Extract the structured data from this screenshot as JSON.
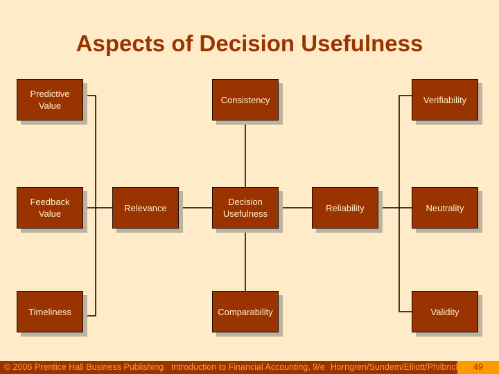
{
  "title": "Aspects of Decision Usefulness",
  "diagram": {
    "nodes": {
      "predictive_value": "Predictive\nValue",
      "feedback_value": "Feedback\nValue",
      "timeliness": "Timeliness",
      "relevance": "Relevance",
      "consistency": "Consistency",
      "decision_usefulness": "Decision\nUsefulness",
      "comparability": "Comparability",
      "reliability": "Reliability",
      "verifiability": "Verifiability",
      "neutrality": "Neutrality",
      "validity": "Validity"
    },
    "edges": [
      [
        "predictive_value",
        "relevance"
      ],
      [
        "feedback_value",
        "relevance"
      ],
      [
        "timeliness",
        "relevance"
      ],
      [
        "relevance",
        "decision_usefulness"
      ],
      [
        "consistency",
        "decision_usefulness"
      ],
      [
        "comparability",
        "decision_usefulness"
      ],
      [
        "decision_usefulness",
        "reliability"
      ],
      [
        "reliability",
        "verifiability"
      ],
      [
        "reliability",
        "neutrality"
      ],
      [
        "reliability",
        "validity"
      ]
    ],
    "colors": {
      "box_fill": "#993300",
      "box_text": "#ffeecc",
      "background": "#ffebc8",
      "shadow": "#bfb3a0",
      "accent": "#ff9900"
    }
  },
  "footer": {
    "copyright": "© 2006 Prentice Hall Business Publishing",
    "book": "Introduction to Financial Accounting, 9/e",
    "authors": "Horngren/Sundem/Elliott/Philbrick",
    "page": "49"
  }
}
